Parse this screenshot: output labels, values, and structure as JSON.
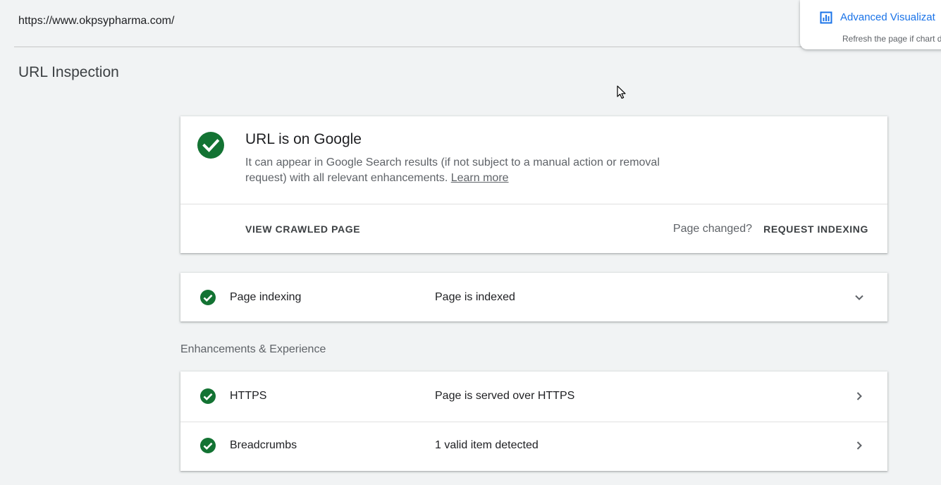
{
  "header": {
    "url": "https://www.okpsypharma.com/",
    "page_title": "URL Inspection"
  },
  "toast": {
    "icon": "bar-chart-icon",
    "title": "Advanced Visualizat",
    "subtitle": "Refresh the page if chart d"
  },
  "status": {
    "icon": "check-circle-icon",
    "title": "URL is on Google",
    "description": "It can appear in Google Search results (if not subject to a manual action or removal request) with all relevant enhancements.",
    "learn_more": "Learn more",
    "view_crawled": "VIEW CRAWLED PAGE",
    "page_changed": "Page changed?",
    "request_indexing": "REQUEST INDEXING"
  },
  "indexing": {
    "label": "Page indexing",
    "value": "Page is indexed",
    "icon": "chevron-down-icon"
  },
  "enhancements": {
    "section_label": "Enhancements & Experience",
    "rows": [
      {
        "label": "HTTPS",
        "value": "Page is served over HTTPS",
        "icon": "chevron-right-icon"
      },
      {
        "label": "Breadcrumbs",
        "value": "1 valid item detected",
        "icon": "chevron-right-icon"
      }
    ]
  },
  "colors": {
    "success_green": "#137333",
    "link_blue": "#1a73e8",
    "background": "#f1f3f4"
  }
}
